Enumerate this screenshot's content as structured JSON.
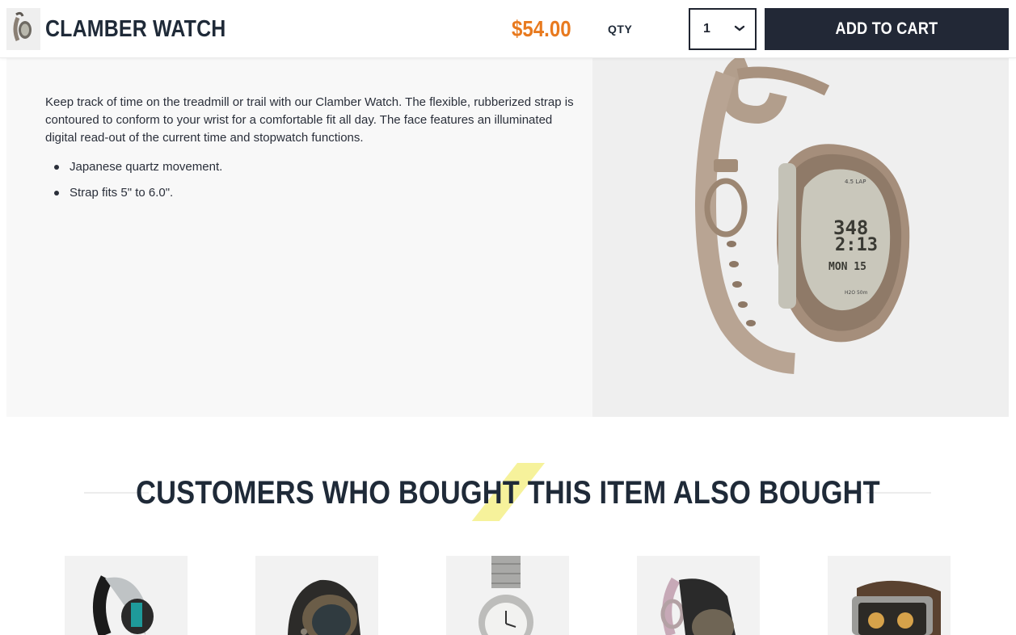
{
  "header": {
    "product_title": "CLAMBER WATCH",
    "price": "$54.00",
    "qty_label": "QTY",
    "qty_value": "1",
    "add_to_cart_label": "ADD TO CART",
    "price_color": "#e87a1f",
    "button_color": "#222836"
  },
  "description": {
    "text": "Keep track of time on the treadmill or trail with our Clamber Watch. The flexible, rubberized strap is contoured to conform to your wrist for a comfortable fit all day. The face features an illuminated digital read-out of the current time and stopwatch functions.",
    "bullets": [
      "Japanese quartz movement.",
      "Strap fits 5\" to 6.0\"."
    ]
  },
  "related": {
    "heading": "CUSTOMERS WHO BOUGHT THIS ITEM ALSO BOUGHT",
    "items": [
      "watch-black-silver",
      "watch-black-bronze",
      "watch-steel-bracelet",
      "watch-black-pink",
      "watch-brown-leather"
    ]
  },
  "icons": {
    "qty_chevron": "chevron-down-icon"
  }
}
